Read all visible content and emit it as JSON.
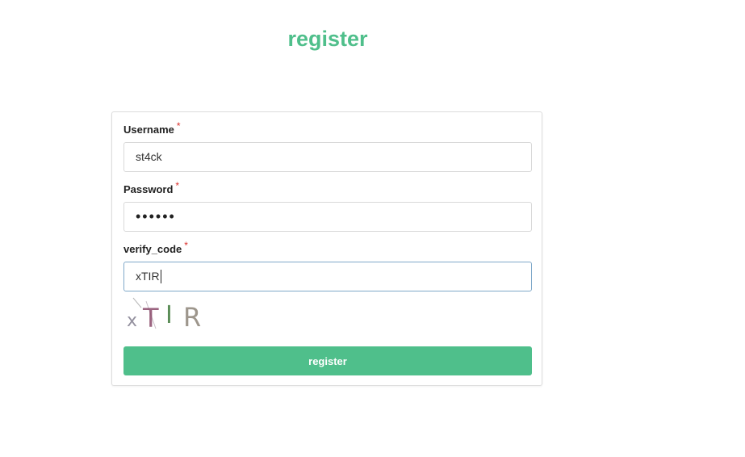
{
  "page": {
    "title": "register"
  },
  "form": {
    "username": {
      "label": "Username",
      "required_mark": "*",
      "value": "st4ck"
    },
    "password": {
      "label": "Password",
      "required_mark": "*",
      "masked_value": "••••••"
    },
    "verify_code": {
      "label": "verify_code",
      "required_mark": "*",
      "value": "xTIR"
    },
    "captcha": {
      "text": "xTIR"
    },
    "submit_label": "register"
  },
  "colors": {
    "accent": "#4fbf8b",
    "required": "#d9302c",
    "focus_border": "#7fa8c9"
  }
}
